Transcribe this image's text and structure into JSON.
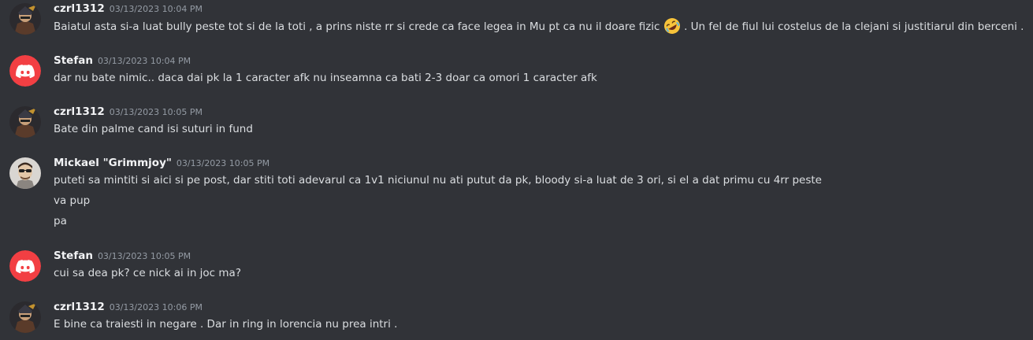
{
  "messages": [
    {
      "username": "czrl1312",
      "timestamp": "03/13/2023 10:04 PM",
      "avatar": "user-avatar-knight",
      "line_before_emoji": "Baiatul asta si-a luat bully peste tot si de la toti , a prins niste rr si crede ca face legea in Mu pt ca nu il doare fizic",
      "emoji": "rolling-on-floor-laughing-emoji",
      "line_after_emoji": ". Un fel de fiul lui costelus de la clejani si justitiarul din berceni ."
    },
    {
      "username": "Stefan",
      "timestamp": "03/13/2023 10:04 PM",
      "avatar": "discord-logo-icon",
      "lines": [
        "dar nu bate nimic.. daca dai pk la 1 caracter afk nu inseamna ca bati 2-3 doar ca omori 1 caracter afk"
      ]
    },
    {
      "username": "czrl1312",
      "timestamp": "03/13/2023 10:05 PM",
      "avatar": "user-avatar-knight",
      "lines": [
        "Bate din palme cand isi suturi in fund"
      ]
    },
    {
      "username": "Mickael \"Grimmjoy\"",
      "timestamp": "03/13/2023 10:05 PM",
      "avatar": "user-avatar-sunglasses",
      "lines": [
        "puteti sa mintiti si aici si pe post, dar stiti toti adevarul ca 1v1 niciunul nu ati putut da pk, bloody si-a luat de 3 ori, si el a dat primu cu 4rr peste",
        "va pup",
        "pa"
      ]
    },
    {
      "username": "Stefan",
      "timestamp": "03/13/2023 10:05 PM",
      "avatar": "discord-logo-icon",
      "lines": [
        "cui sa dea pk? ce nick ai in joc ma?"
      ]
    },
    {
      "username": "czrl1312",
      "timestamp": "03/13/2023 10:06 PM",
      "avatar": "user-avatar-knight",
      "lines": [
        "E bine ca traiesti in negare . Dar in ring in lorencia nu prea intri ."
      ]
    }
  ],
  "colors": {
    "background": "#313338",
    "username": "#f2f3f5",
    "timestamp": "#949ba4",
    "message_text": "#dbdee1",
    "discord_red": "#f23f43"
  }
}
